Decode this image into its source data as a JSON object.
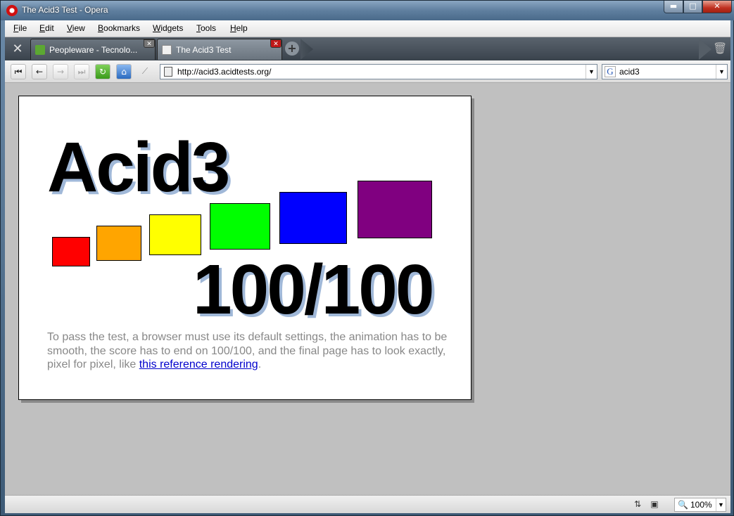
{
  "window": {
    "title": "The Acid3 Test - Opera",
    "minimize_glyph": "▬",
    "maximize_glyph": "□",
    "close_glyph": "✕"
  },
  "menu": [
    "File",
    "Edit",
    "View",
    "Bookmarks",
    "Widgets",
    "Tools",
    "Help"
  ],
  "tabs": [
    {
      "label": "Peopleware - Tecnolo...",
      "icon": "green-leaf-icon",
      "close": "✕"
    },
    {
      "label": "The Acid3 Test",
      "icon": "page-icon",
      "close": "✕"
    }
  ],
  "toolbar": {
    "rewind_glyph": "⏮",
    "back_glyph": "←",
    "forward_glyph": "→",
    "fastforward_glyph": "⏭",
    "reload_glyph": "↻",
    "home_glyph": "⌂",
    "wand_glyph": "⟋",
    "new_tab_glyph": "+",
    "trash_glyph": "🗑",
    "tools_glyph": "✕"
  },
  "address": {
    "url": "http://acid3.acidtests.org/",
    "dropdown": "▼"
  },
  "search": {
    "engine_letter": "G",
    "query": "acid3",
    "dropdown": "▼"
  },
  "page": {
    "heading": "Acid3",
    "score": "100/100",
    "caption_before": "To pass the test, a browser must use its default settings, the animation has to be smooth, the score has to end on 100/100, and the final page has to look exactly, pixel for pixel, like ",
    "caption_link": "this reference rendering",
    "caption_after": ".",
    "boxes": [
      {
        "name": "box-red",
        "color": "#ff0000"
      },
      {
        "name": "box-orange",
        "color": "#ffa500"
      },
      {
        "name": "box-yellow",
        "color": "#ffff00"
      },
      {
        "name": "box-lime",
        "color": "#00ff00"
      },
      {
        "name": "box-blue",
        "color": "#0000ff"
      },
      {
        "name": "box-purple",
        "color": "#800080"
      }
    ]
  },
  "status": {
    "zoom": "100%",
    "zoom_glyph": "🔍",
    "dropdown": "▼",
    "network_glyph": "⇅",
    "camera_glyph": "▣"
  }
}
